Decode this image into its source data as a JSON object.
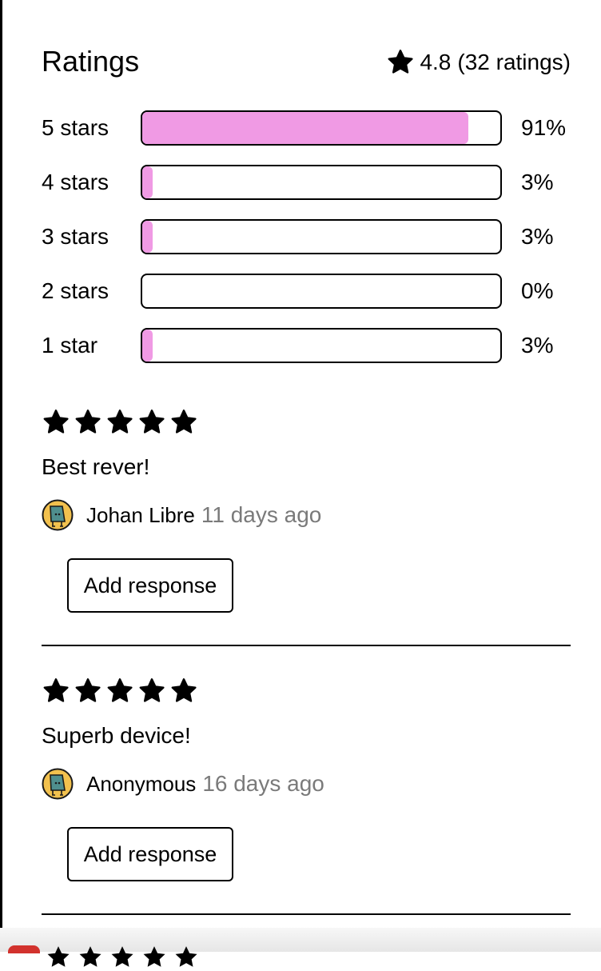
{
  "ratings": {
    "title": "Ratings",
    "average": "4.8",
    "count_text": "(32 ratings)",
    "rows": [
      {
        "label": "5 stars",
        "percent_text": "91%",
        "fraction": 0.91
      },
      {
        "label": "4 stars",
        "percent_text": "3%",
        "fraction": 0.03
      },
      {
        "label": "3 stars",
        "percent_text": "3%",
        "fraction": 0.03
      },
      {
        "label": "2 stars",
        "percent_text": "0%",
        "fraction": 0.0
      },
      {
        "label": "1 star",
        "percent_text": "3%",
        "fraction": 0.03
      }
    ],
    "bar_color": "#f09ae4"
  },
  "reviews": [
    {
      "stars": 5,
      "title": "Best rever!",
      "author": "Johan Libre",
      "time_ago": "11 days ago",
      "button_label": "Add response"
    },
    {
      "stars": 5,
      "title": "Superb device!",
      "author": "Anonymous",
      "time_ago": "16 days ago",
      "button_label": "Add response"
    }
  ],
  "icons": {
    "rating": "star-icon",
    "avatar": "avatar-icon"
  }
}
